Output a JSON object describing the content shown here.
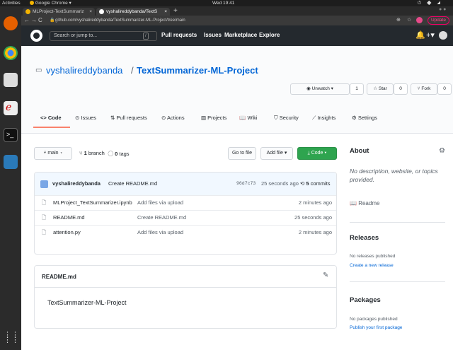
{
  "system": {
    "activities": "Activities",
    "app": "Google Chrome ▾",
    "clock": "Wed 19:41"
  },
  "browser": {
    "tabs": [
      {
        "title": "MLProject-TextSummariz"
      },
      {
        "title": "vyshalireddybanda/TextS"
      }
    ],
    "url": "github.com/vyshalireddybanda/TextSummarizer-ML-Project/tree/main",
    "update_label": "Update"
  },
  "gh": {
    "search_placeholder": "Search or jump to...",
    "slash": "/",
    "nav": [
      "Pull requests",
      "Issues",
      "Marketplace",
      "Explore"
    ]
  },
  "repo": {
    "owner": "vyshalireddybanda",
    "sep": "/",
    "name": "TextSummarizer-ML-Project",
    "unwatch": "Unwatch ▾",
    "watch_count": "1",
    "star": "Star",
    "star_count": "0",
    "fork": "Fork",
    "fork_count": "0",
    "tabs": [
      "Code",
      "Issues",
      "Pull requests",
      "Actions",
      "Projects",
      "Wiki",
      "Security",
      "Insights",
      "Settings"
    ]
  },
  "toolbar": {
    "branch": "main ▾",
    "branches_num": "1",
    "branches_label": "branch",
    "tags_num": "0",
    "tags_label": "tags",
    "goto": "Go to file",
    "add": "Add file ▾",
    "code": "Code ▾"
  },
  "commit": {
    "author": "vyshalireddybanda",
    "message": "Create README.md",
    "sha": "96d7c73",
    "time": "25 seconds ago",
    "count": "5",
    "count_label": "commits"
  },
  "files": [
    {
      "name": "MLProject_TextSummarizer.ipynb",
      "msg": "Add files via upload",
      "time": "2 minutes ago"
    },
    {
      "name": "README.md",
      "msg": "Create README.md",
      "time": "25 seconds ago"
    },
    {
      "name": "attention.py",
      "msg": "Add files via upload",
      "time": "2 minutes ago"
    }
  ],
  "readme": {
    "title": "README.md",
    "content": "TextSummarizer-ML-Project"
  },
  "about": {
    "heading": "About",
    "desc": "No description, website, or topics provided.",
    "readme": "Readme"
  },
  "releases": {
    "heading": "Releases",
    "none": "No releases published",
    "create": "Create a new release"
  },
  "packages": {
    "heading": "Packages",
    "none": "No packages published",
    "publish": "Publish your first package"
  }
}
